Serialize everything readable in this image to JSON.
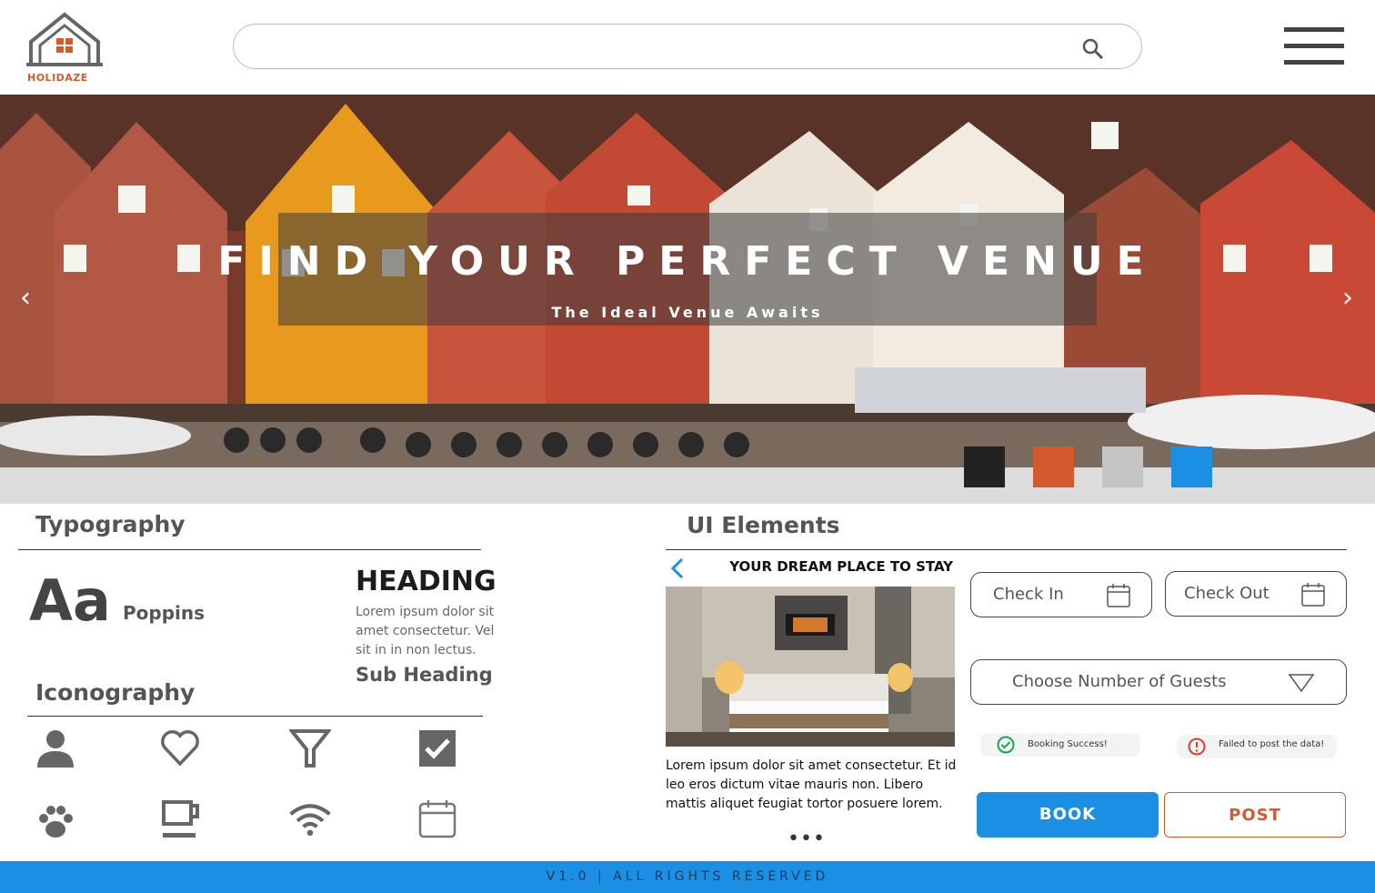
{
  "brand": {
    "name": "HOLIDAZE",
    "accent": "#d45a2e"
  },
  "header": {
    "search_placeholder": ""
  },
  "hero": {
    "title": "FIND YOUR PERFECT VENUE",
    "subtitle": "The Ideal Venue Awaits",
    "swatches": [
      "#222222",
      "#d45a2e",
      "#c4c4c4",
      "#1a8fe3"
    ]
  },
  "typography": {
    "title": "Typography",
    "sample": "Aa",
    "font_name": "Poppins",
    "heading": "HEADING",
    "body": "Lorem ipsum dolor sit amet consectetur. Vel sit in in non lectus.",
    "subheading": "Sub Heading"
  },
  "iconography": {
    "title": "Iconography",
    "icons": [
      "user-icon",
      "heart-icon",
      "filter-icon",
      "checkbox-icon",
      "paw-icon",
      "coffee-icon",
      "wifi-icon",
      "calendar-icon"
    ]
  },
  "ui_elements": {
    "title": "UI Elements",
    "card": {
      "title": "YOUR DREAM PLACE TO STAY",
      "text": "Lorem ipsum dolor sit amet consectetur. Et id leo eros dictum vitae mauris non. Libero mattis aliquet feugiat tortor posuere lorem.",
      "dots": "•••"
    },
    "check_in": "Check In",
    "check_out": "Check Out",
    "guests": "Choose Number of Guests",
    "success": "Booking Success!",
    "error": "Failed to post the data!",
    "book": "BOOK",
    "post": "POST"
  },
  "footer": {
    "text": "V1.0 | ALL RIGHTS RESERVED"
  }
}
